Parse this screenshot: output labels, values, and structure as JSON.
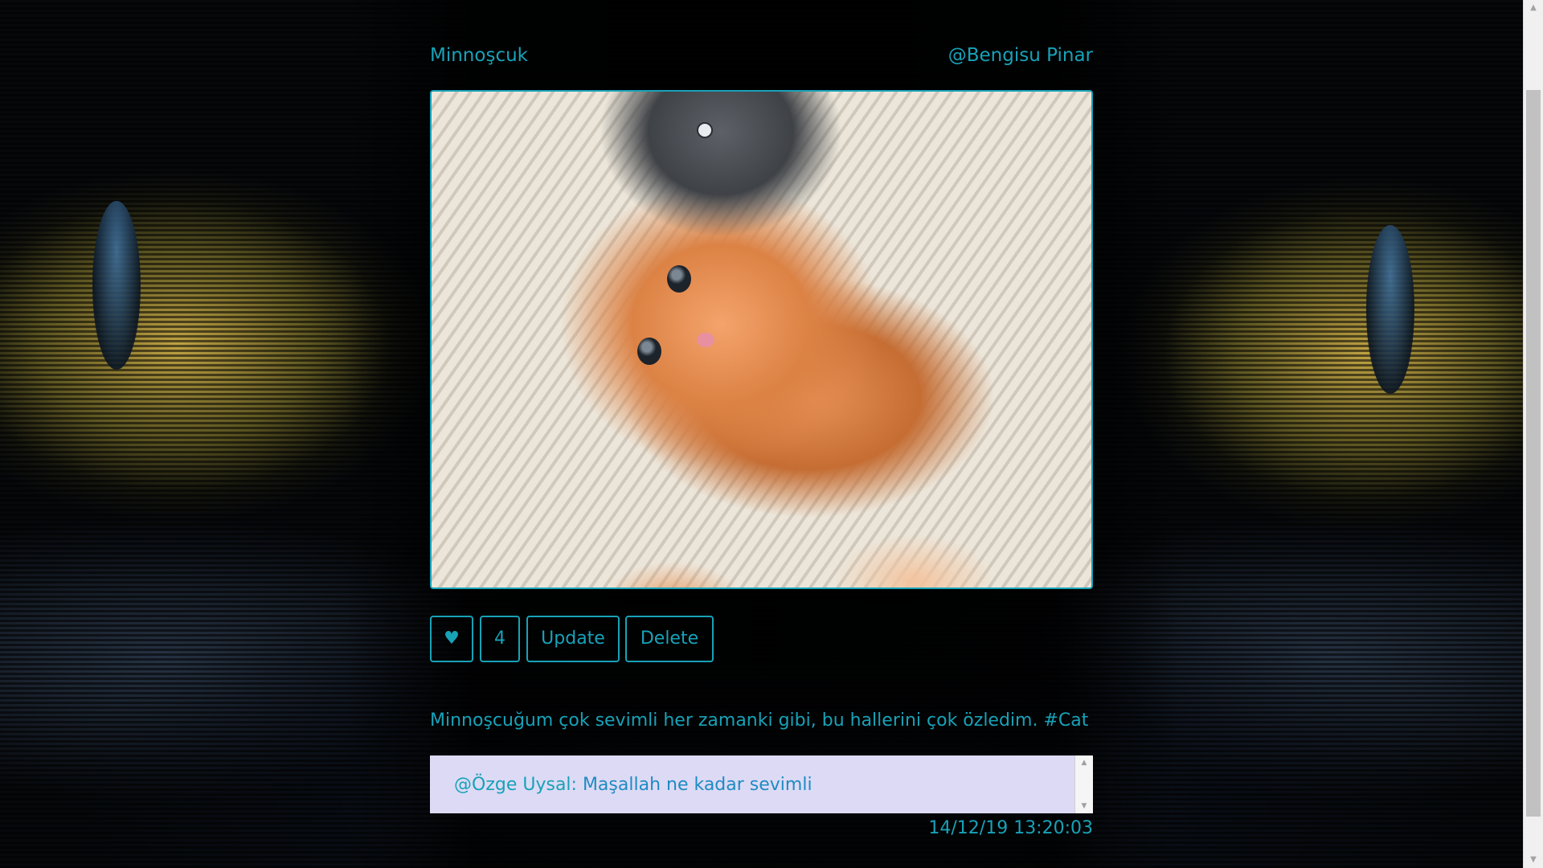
{
  "post": {
    "title": "Minnoşcuk",
    "author": "@Bengisu Pinar",
    "image_alt": "kitten",
    "like_icon": "♥",
    "like_count": "4",
    "update_label": "Update",
    "delete_label": "Delete",
    "caption": "Minnoşcuğum çok sevimli her zamanki gibi, bu hallerini çok özledim. #Cat",
    "timestamp": "14/12/19 13:20:03"
  },
  "comments": [
    {
      "author": "@Özge Uysal:",
      "text": "Maşallah ne kadar sevimli"
    }
  ],
  "colors": {
    "accent": "#17a2b8",
    "comment_bg": "#dddaf5"
  },
  "icons": {
    "scroll_up": "▲",
    "scroll_down": "▼"
  }
}
